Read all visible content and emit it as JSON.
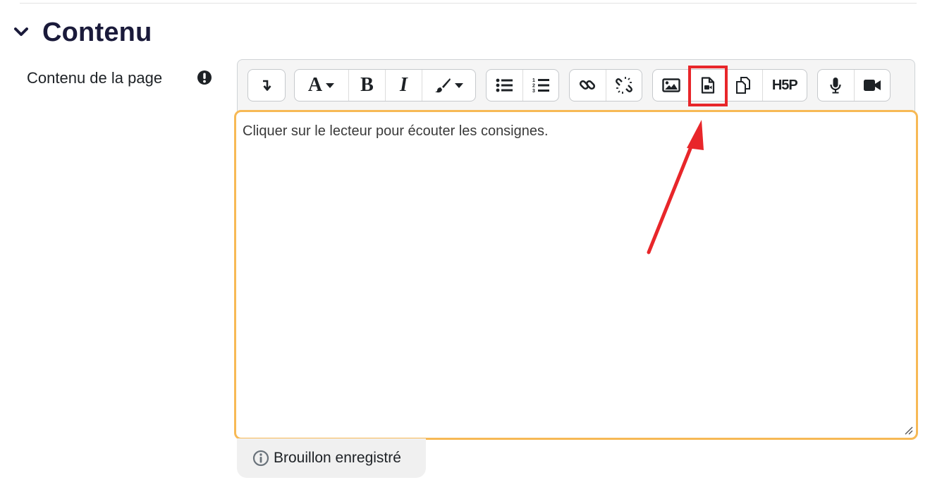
{
  "section": {
    "title": "Contenu",
    "icon": "chevron-down-icon"
  },
  "field": {
    "label": "Contenu de la page",
    "required_icon": "exclamation-circle-icon"
  },
  "toolbar": {
    "groups": [
      {
        "name": "collapse",
        "buttons": [
          {
            "icon": "arrow-down-return-icon"
          }
        ]
      },
      {
        "name": "style",
        "buttons": [
          {
            "label": "A",
            "icon": "font-style-icon"
          },
          {
            "label": "B",
            "icon": "bold-icon"
          },
          {
            "label": "I",
            "icon": "italic-icon"
          },
          {
            "icon": "paint-brush-icon"
          }
        ]
      },
      {
        "name": "list",
        "buttons": [
          {
            "icon": "unordered-list-icon"
          },
          {
            "icon": "ordered-list-icon"
          }
        ]
      },
      {
        "name": "links",
        "buttons": [
          {
            "icon": "link-icon"
          },
          {
            "icon": "unlink-icon"
          }
        ]
      },
      {
        "name": "files",
        "buttons": [
          {
            "icon": "image-icon"
          },
          {
            "icon": "media-file-icon"
          },
          {
            "icon": "manage-files-icon"
          },
          {
            "label": "H5P",
            "icon": "h5p-icon"
          }
        ]
      },
      {
        "name": "recordrtc",
        "buttons": [
          {
            "icon": "microphone-icon"
          },
          {
            "icon": "video-camera-icon"
          }
        ]
      }
    ]
  },
  "editor": {
    "content": "Cliquer sur le lecteur pour écouter les consignes."
  },
  "draft": {
    "status": "Brouillon enregistré",
    "icon": "info-circle-icon"
  },
  "colors": {
    "focus_border": "#f7b955",
    "annotation": "#e8262a",
    "title": "#1a1a3a"
  }
}
